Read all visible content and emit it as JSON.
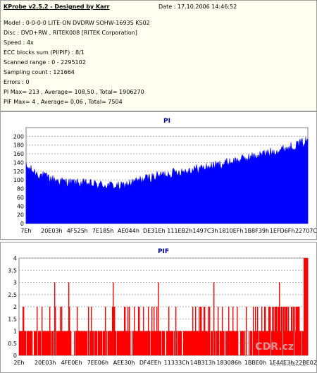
{
  "info": {
    "title": "KProbe v2.5.2 - Designed by Karr",
    "date": "Date : 17.10.2006 14:46:52",
    "lines": [
      "Model : 0-0-0-0 LITE-ON DVDRW SOHW-1693S KS02",
      "Disc : DVD+RW , RITEK008 [RITEK Corporation]",
      "Speed : 4x",
      "ECC blocks sum (PI/PIF) : 8/1",
      "Scanned range : 0 - 2295102",
      "Sampling count : 121664",
      "Errors : 0",
      "PI Max= 213 , Average= 108,50 , Total= 1906270",
      "PIF Max= 4 , Average= 0,06 , Total= 7504"
    ]
  },
  "chart_data": [
    {
      "type": "area",
      "title": "PI",
      "color": "#0000ff",
      "ylim": [
        0,
        220
      ],
      "yticks": [
        0,
        20,
        40,
        60,
        80,
        100,
        120,
        140,
        160,
        180,
        200
      ],
      "xlim": [
        0,
        2295102
      ],
      "xtick_labels": [
        "7Eh",
        "20E03h",
        "4F525h",
        "7E185h",
        "AE044h",
        "DE31Eh",
        "111EB2h",
        "1497C3h",
        "1810EFh",
        "1B8F39h",
        "1EFD6Fh",
        "22707Ch"
      ],
      "grid": true,
      "profile": [
        [
          0,
          130
        ],
        [
          100000,
          113
        ],
        [
          200000,
          103
        ],
        [
          300000,
          96
        ],
        [
          400000,
          93
        ],
        [
          500000,
          91
        ],
        [
          600000,
          89
        ],
        [
          700000,
          87
        ],
        [
          780000,
          85
        ],
        [
          820000,
          90
        ],
        [
          900000,
          97
        ],
        [
          1000000,
          105
        ],
        [
          1100000,
          111
        ],
        [
          1200000,
          117
        ],
        [
          1300000,
          121
        ],
        [
          1400000,
          126
        ],
        [
          1500000,
          131
        ],
        [
          1600000,
          137
        ],
        [
          1700000,
          144
        ],
        [
          1800000,
          150
        ],
        [
          1900000,
          157
        ],
        [
          2000000,
          164
        ],
        [
          2100000,
          171
        ],
        [
          2200000,
          180
        ],
        [
          2295102,
          190
        ]
      ],
      "max": 213
    },
    {
      "type": "bar",
      "title": "PIF",
      "color": "#ff0000",
      "ylim": [
        0,
        4
      ],
      "yticks": [
        0,
        0.5,
        1,
        1.5,
        2,
        2.5,
        3,
        3.5,
        4
      ],
      "ytick_labels": [
        "0",
        "0.5",
        "1",
        "1.5",
        "2",
        "2.5",
        "3",
        "3.5",
        "4"
      ],
      "xlim": [
        0,
        2295102
      ],
      "xtick_labels": [
        "2Eh",
        "20E03h",
        "4FE0Eh",
        "7EE06h",
        "AEE30h",
        "DF4EEh",
        "11333Ch",
        "14B313h",
        "183086h",
        "1BBE0h",
        "1F44E3h",
        "22BE02h"
      ],
      "grid": true,
      "max": 4
    }
  ],
  "watermark": "CDR.cz",
  "watermark_url": "www.cdr.cz"
}
